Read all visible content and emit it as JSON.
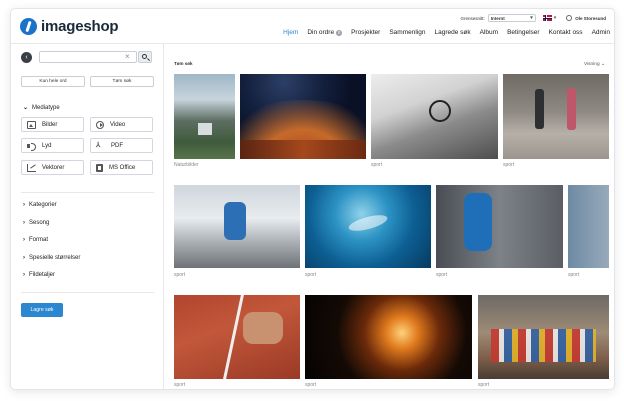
{
  "brand": {
    "name": "imageshop",
    "accent": "#2a87d0"
  },
  "header": {
    "interface_label": "Grensesnitt:",
    "interface_value": "Internt",
    "language_flag": "norway-flag-icon",
    "user_name": "Ole Storesund"
  },
  "nav": {
    "items": [
      {
        "label": "Hjem",
        "active": true
      },
      {
        "label": "Din ordre",
        "badge": "0"
      },
      {
        "label": "Prosjekter"
      },
      {
        "label": "Sammenlign"
      },
      {
        "label": "Lagrede søk"
      },
      {
        "label": "Album"
      },
      {
        "label": "Betingelser"
      },
      {
        "label": "Kontakt oss"
      },
      {
        "label": "Admin"
      }
    ]
  },
  "sidebar": {
    "search": {
      "value": "",
      "placeholder": ""
    },
    "buttons": {
      "whole_words": "Kun hele ord",
      "clear_search": "Tøm søk"
    },
    "media_type": {
      "title": "Mediatype",
      "types": [
        {
          "label": "Bilder",
          "icon": "image-icon"
        },
        {
          "label": "Video",
          "icon": "video-icon"
        },
        {
          "label": "Lyd",
          "icon": "audio-icon"
        },
        {
          "label": "PDF",
          "icon": "pdf-icon"
        },
        {
          "label": "Vektorer",
          "icon": "vector-icon"
        },
        {
          "label": "MS Office",
          "icon": "office-icon"
        }
      ]
    },
    "filters": [
      "Kategorier",
      "Sesong",
      "Format",
      "Spesielle størrelser",
      "Fildetaljer"
    ],
    "save_search": "Lagre søk"
  },
  "main": {
    "breadcrumb": "Tøm søk",
    "sort_label": "Visning",
    "rows": [
      [
        {
          "caption": "Naturbilder"
        },
        {
          "caption": ""
        },
        {
          "caption": "sport"
        },
        {
          "caption": "sport"
        }
      ],
      [
        {
          "caption": "sport"
        },
        {
          "caption": "sport"
        },
        {
          "caption": "sport"
        },
        {
          "caption": "sport"
        }
      ],
      [
        {
          "caption": "sport"
        },
        {
          "caption": "sport"
        },
        {
          "caption": "sport"
        }
      ]
    ]
  }
}
